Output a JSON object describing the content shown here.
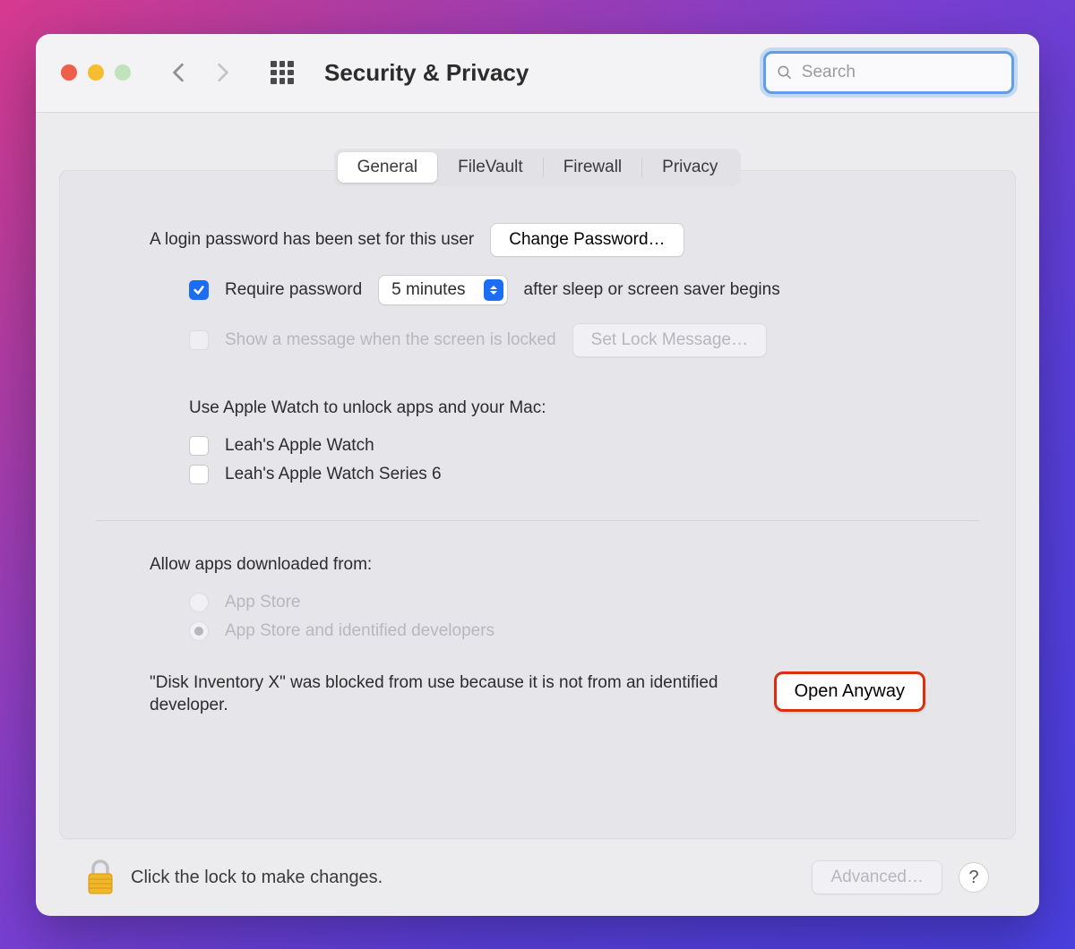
{
  "header": {
    "title": "Security & Privacy",
    "search_placeholder": "Search"
  },
  "tabs": {
    "general": "General",
    "filevault": "FileVault",
    "firewall": "Firewall",
    "privacy": "Privacy"
  },
  "general": {
    "login_password_text": "A login password has been set for this user",
    "change_password_btn": "Change Password…",
    "require_password_label": "Require password",
    "require_password_delay": "5 minutes",
    "require_password_after": "after sleep or screen saver begins",
    "show_message_label": "Show a message when the screen is locked",
    "set_lock_message_btn": "Set Lock Message…",
    "apple_watch_heading": "Use Apple Watch to unlock apps and your Mac:",
    "apple_watch_1": "Leah's Apple Watch",
    "apple_watch_2": "Leah's Apple Watch Series 6",
    "allow_apps_heading": "Allow apps downloaded from:",
    "allow_appstore": "App Store",
    "allow_identified": "App Store and identified developers",
    "blocked_message": "\"Disk Inventory X\" was blocked from use because it is not from an identified developer.",
    "open_anyway_btn": "Open Anyway"
  },
  "footer": {
    "lock_text": "Click the lock to make changes.",
    "advanced_btn": "Advanced…",
    "help_btn": "?"
  }
}
